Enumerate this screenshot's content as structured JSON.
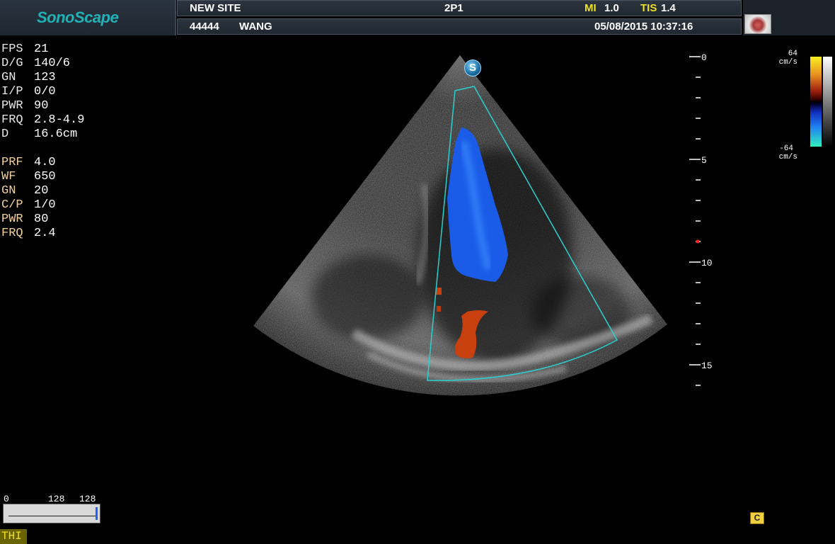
{
  "header": {
    "logo": "SonoScape",
    "site": "NEW SITE",
    "probe": "2P1",
    "mi_label": "MI",
    "mi_value": "1.0",
    "tis_label": "TIS",
    "tis_value": "1.4",
    "patient_id": "44444",
    "patient_name": "WANG",
    "datetime": "05/08/2015 10:37:16"
  },
  "bmode_params": [
    {
      "label": "FPS",
      "value": "21"
    },
    {
      "label": "D/G",
      "value": "140/6"
    },
    {
      "label": "GN",
      "value": "123"
    },
    {
      "label": "I/P",
      "value": "0/0"
    },
    {
      "label": "PWR",
      "value": "90"
    },
    {
      "label": "FRQ",
      "value": "2.8-4.9"
    },
    {
      "label": "D",
      "value": "16.6cm"
    }
  ],
  "color_params": [
    {
      "label": "PRF",
      "value": "4.0"
    },
    {
      "label": "WF",
      "value": "650"
    },
    {
      "label": "GN",
      "value": "20"
    },
    {
      "label": "C/P",
      "value": "1/0"
    },
    {
      "label": "PWR",
      "value": "80"
    },
    {
      "label": "FRQ",
      "value": "2.4"
    }
  ],
  "depth_scale": {
    "labels": [
      "0",
      "5",
      "10",
      "15"
    ],
    "max_cm": 16.6
  },
  "color_bar": {
    "top_value": "64",
    "top_unit": "cm/s",
    "bottom_value": "-64",
    "bottom_unit": "cm/s"
  },
  "gain_scale": {
    "min": "0",
    "mid": "128",
    "max": "128"
  },
  "mode_indicator": "THI",
  "probe_badge": "S",
  "cine_icon": "C",
  "colors": {
    "sector_outline": "#2ad0d0",
    "logo": "#1fb3b8",
    "warning_label": "#f0e020"
  }
}
